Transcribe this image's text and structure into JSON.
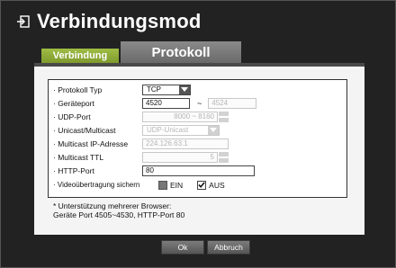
{
  "title": "Verbindungsmod",
  "icons": {
    "title": "exit-arrow-icon",
    "select": "dropdown-arrow-icon",
    "checked": "checkmark-icon"
  },
  "tabs": [
    {
      "label": "Verbindung",
      "active": false
    },
    {
      "label": "Protokoll",
      "active": true
    }
  ],
  "form": {
    "protocol_type": {
      "label": "· Protokoll Typ",
      "value": "TCP"
    },
    "device_port": {
      "label": "· Geräteport",
      "from": "4520",
      "separator": "~",
      "to": "4524"
    },
    "udp_port": {
      "label": "· UDP-Port",
      "value": "8000 ~ 8160"
    },
    "unicast_multicast": {
      "label": "· Unicast/Multicast",
      "value": "UDP-Unicast"
    },
    "multicast_ip": {
      "label": "· Multicast IP-Adresse",
      "value": "224.126.63.1"
    },
    "multicast_ttl": {
      "label": "· Multicast TTL",
      "value": "5"
    },
    "http_port": {
      "label": "· HTTP-Port",
      "value": "80"
    },
    "video_secure": {
      "label": "· Videoübertragung sichern",
      "options": [
        {
          "label": "EIN",
          "checked": false
        },
        {
          "label": "AUS",
          "checked": true
        }
      ]
    }
  },
  "note": {
    "line1": "* Unterstützung mehrerer Browser:",
    "line2": "Geräte Port 4505~4530, HTTP-Port 80"
  },
  "buttons": {
    "ok": "Ok",
    "cancel": "Abbruch"
  },
  "colors": {
    "dialog_bg": "#222222",
    "tab_active": "#777777",
    "tab_inactive": "#8fad38",
    "panel_bg": "#f4f4f4"
  }
}
